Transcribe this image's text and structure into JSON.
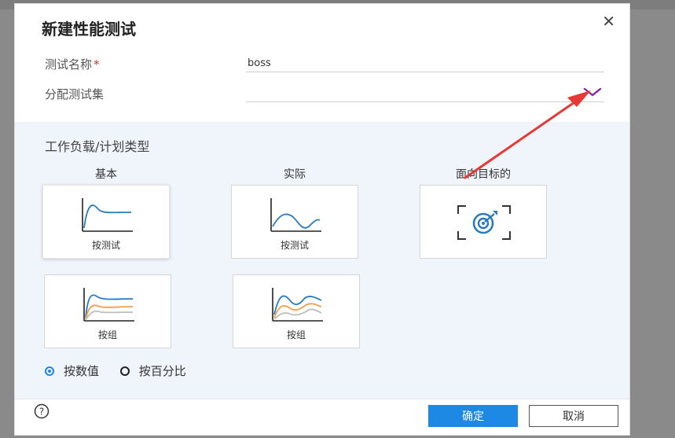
{
  "dialog": {
    "title": "新建性能测试",
    "close_icon": "close-icon"
  },
  "form": {
    "test_name_label": "测试名称",
    "required_mark": "*",
    "test_name_value": "boss",
    "test_set_label": "分配测试集",
    "test_set_value": ""
  },
  "workload": {
    "section_title": "工作负载/计划类型",
    "columns": [
      "基本",
      "实际",
      "面向目标的"
    ],
    "cards": [
      {
        "caption": "按测试",
        "icon": "basic-single-curve-icon"
      },
      {
        "caption": "按测试",
        "icon": "real-wave-curve-icon"
      },
      {
        "caption": "",
        "icon": "goal-target-icon"
      },
      {
        "caption": "按组",
        "icon": "basic-group-curves-icon"
      },
      {
        "caption": "按组",
        "icon": "real-group-curves-icon"
      }
    ]
  },
  "distribution": {
    "option_value": "按数值",
    "option_percent": "按百分比",
    "selected": "按数值"
  },
  "footer": {
    "ok_label": "确定",
    "cancel_label": "取消",
    "help_icon": "help-icon"
  },
  "colors": {
    "accent": "#1e88e5",
    "curve_blue": "#2a7bbd",
    "curve_orange": "#f0a04a",
    "curve_gray": "#bdbdbd",
    "annotation_red": "#e53935",
    "chevron_purple": "#8e24aa"
  }
}
